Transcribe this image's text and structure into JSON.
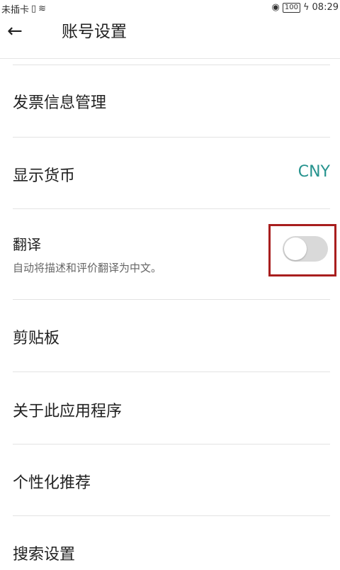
{
  "status_bar": {
    "left_text": "未插卡",
    "battery": "100",
    "time": "08:29"
  },
  "app_bar": {
    "back_icon": "arrow-left-icon",
    "title": "账号设置"
  },
  "settings": {
    "invoice": {
      "label": "发票信息管理"
    },
    "currency": {
      "label": "显示货币",
      "value": "CNY"
    },
    "translate": {
      "label": "翻译",
      "description": "自动将描述和评价翻译为中文。",
      "enabled": false
    },
    "clipboard": {
      "label": "剪贴板"
    },
    "about": {
      "label": "关于此应用程序"
    },
    "personalized": {
      "label": "个性化推荐"
    },
    "search_settings": {
      "label": "搜索设置"
    }
  },
  "colors": {
    "accent": "#26938e",
    "highlight_outline": "#a81e1e",
    "toggle_off": "#d9d9d9"
  }
}
